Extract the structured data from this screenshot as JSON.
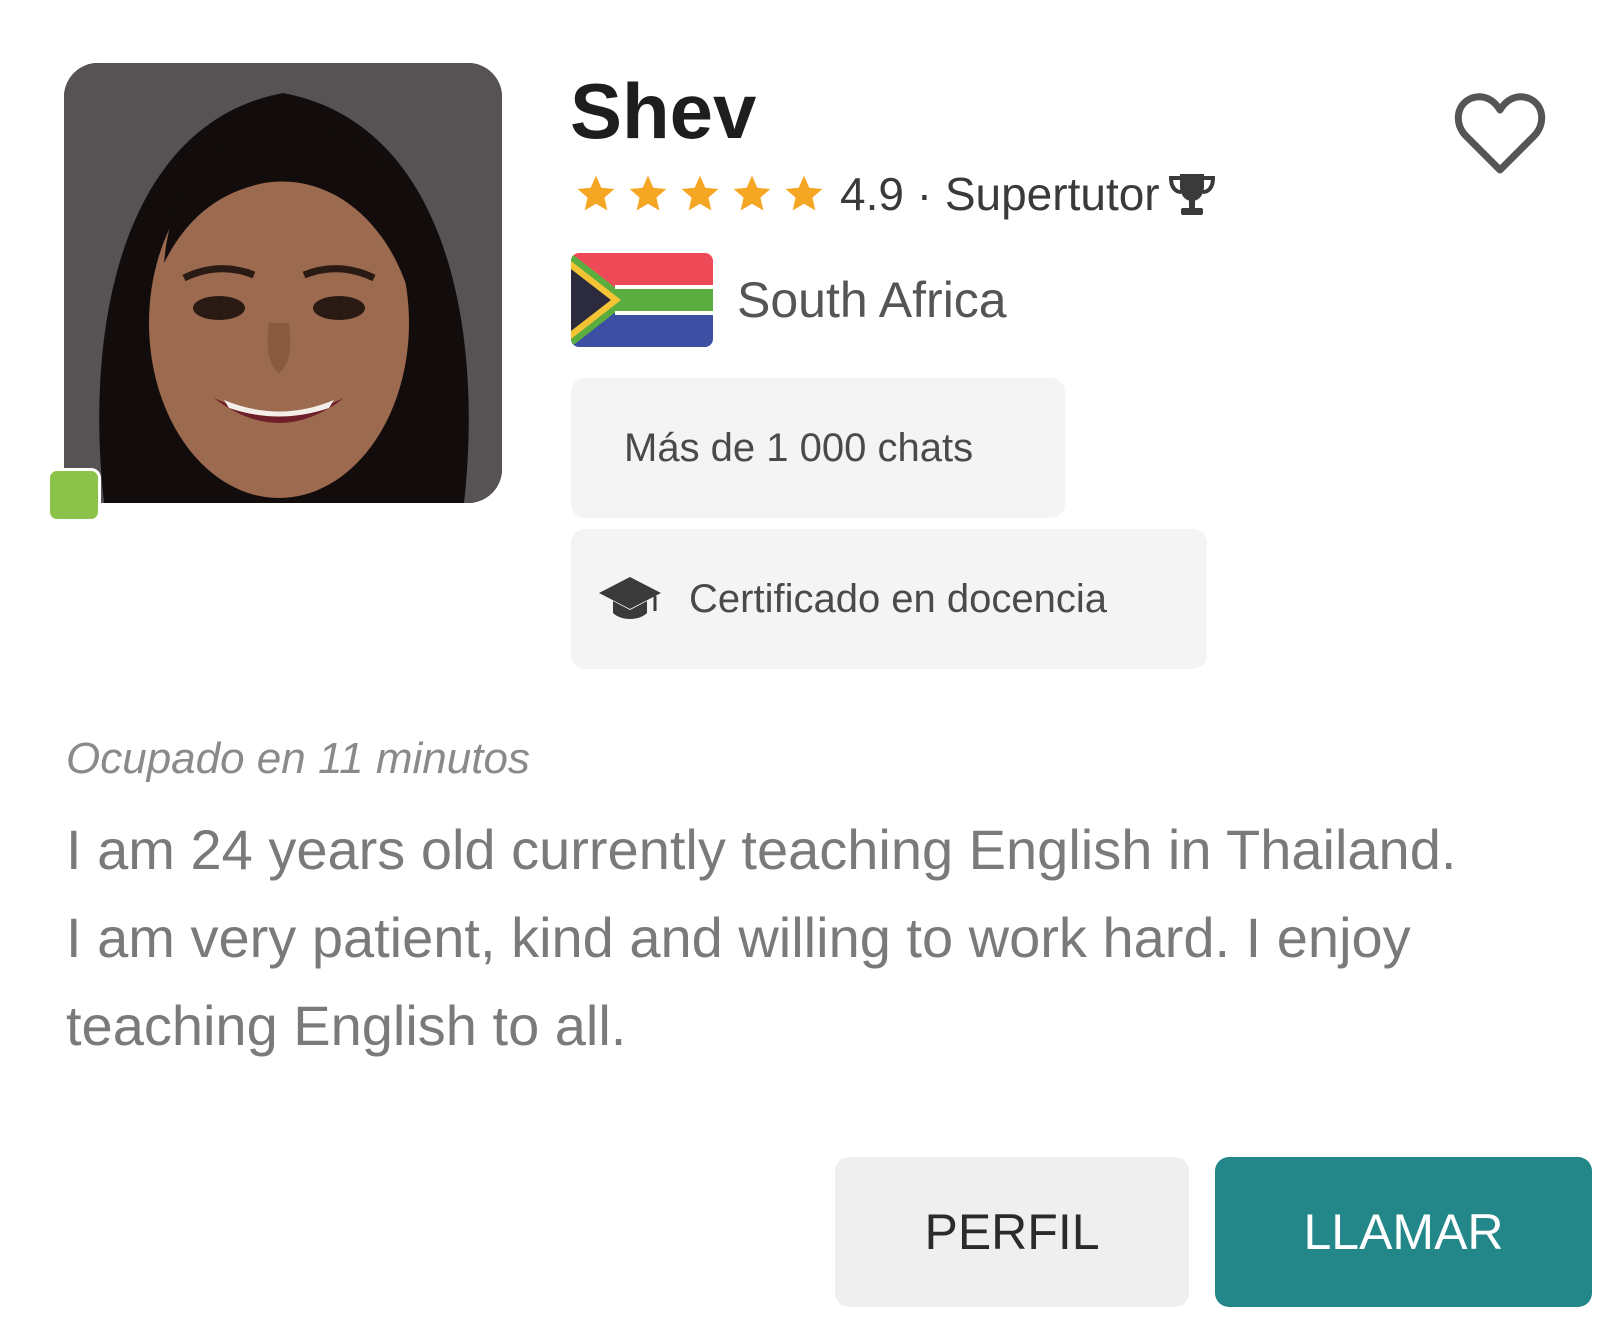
{
  "tutor": {
    "name": "Shev",
    "rating": "4.9",
    "rating_suffix": "4.9 · Supertutor",
    "stars": 5,
    "country": "South Africa",
    "online": true
  },
  "badges": {
    "chats": "Más de 1 000 chats",
    "certified": "Certificado en docencia"
  },
  "status": {
    "busy_text": "Ocupado en 11 minutos"
  },
  "bio": {
    "text": "I am 24 years old currently teaching English in Thailand. I am very patient, kind and willing to work hard. I enjoy teaching English to all."
  },
  "actions": {
    "profile_label": "PERFIL",
    "call_label": "LLAMAR"
  },
  "icons": {
    "favorite": "heart-outline-icon",
    "star": "star-icon",
    "trophy": "trophy-icon",
    "flag": "south-africa-flag-icon",
    "certificate": "graduation-cap-icon"
  },
  "colors": {
    "accent": "#23878a",
    "star": "#f5a623",
    "online": "#8bc34a",
    "badge_bg": "#f4f4f4"
  }
}
